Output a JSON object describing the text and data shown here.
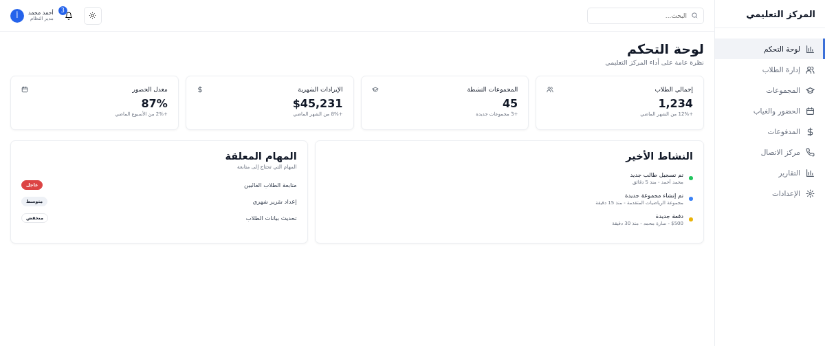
{
  "sidebar": {
    "title": "المركز التعليمي",
    "items": [
      {
        "label": "لوحة التحكم",
        "selected": true
      },
      {
        "label": "إدارة الطلاب",
        "selected": false
      },
      {
        "label": "المجموعات",
        "selected": false
      },
      {
        "label": "الحضور والغياب",
        "selected": false
      },
      {
        "label": "المدفوعات",
        "selected": false
      },
      {
        "label": "مركز الاتصال",
        "selected": false
      },
      {
        "label": "التقارير",
        "selected": false
      },
      {
        "label": "الإعدادات",
        "selected": false
      }
    ]
  },
  "topbar": {
    "search": {
      "placeholder": "البحث..."
    },
    "notifications": {
      "count": "3"
    },
    "user": {
      "initial": "أ",
      "name": "أحمد محمد",
      "role": "مدير النظام"
    }
  },
  "page": {
    "title": "لوحة التحكم",
    "subtitle": "نظرة عامة على أداء المركز التعليمي"
  },
  "stats": [
    {
      "label": "إجمالي الطلاب",
      "value": "1,234",
      "change": "+12% من الشهر الماضي"
    },
    {
      "label": "المجموعات النشطة",
      "value": "45",
      "change": "+3 مجموعات جديدة"
    },
    {
      "label": "الإيرادات الشهرية",
      "value": "$45,231",
      "change": "+8% من الشهر الماضي"
    },
    {
      "label": "معدل الحضور",
      "value": "87%",
      "change": "+2% من الأسبوع الماضي"
    }
  ],
  "activity": {
    "title": "النشاط الأخير",
    "items": [
      {
        "title": "تم تسجيل طالب جديد",
        "detail": "محمد أحمد - منذ 5 دقائق",
        "color": "#22c55e"
      },
      {
        "title": "تم إنشاء مجموعة جديدة",
        "detail": "مجموعة الرياضيات المتقدمة - منذ 15 دقيقة",
        "color": "#3b82f6"
      },
      {
        "title": "دفعة جديدة",
        "detail": "$500 - سارة محمد - منذ 30 دقيقة",
        "color": "#eab308"
      }
    ]
  },
  "tasks": {
    "title": "المهام المعلقة",
    "subtitle": "المهام التي تحتاج إلى متابعة",
    "items": [
      {
        "label": "متابعة الطلاب الغائبين",
        "priority": "عاجل",
        "kind": "high"
      },
      {
        "label": "إعداد تقرير شهري",
        "priority": "متوسط",
        "kind": "medium"
      },
      {
        "label": "تحديث بيانات الطلاب",
        "priority": "منخفض",
        "kind": "low"
      }
    ]
  }
}
